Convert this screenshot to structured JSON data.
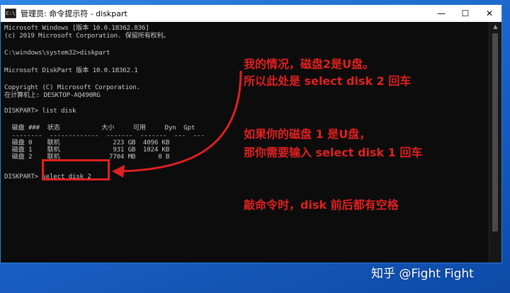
{
  "window": {
    "icon_text": "C:\\",
    "title": "管理员: 命令提示符 - diskpart",
    "minimize_glyph": "—",
    "maximize_glyph": "☐",
    "close_glyph": "✕"
  },
  "console_lines": [
    "Microsoft Windows [版本 10.0.18362.836]",
    "(c) 2019 Microsoft Corporation. 保留所有权利。",
    "",
    "C:\\windows\\system32>diskpart",
    "",
    "Microsoft DiskPart 版本 10.0.18362.1",
    "",
    "Copyright (C) Microsoft Corporation.",
    "在计算机上: DESKTOP-AQ490RG",
    "",
    "DISKPART> list disk",
    "",
    "  磁盘 ###  状态           大小     可用     Dyn  Gpt",
    "  --------  -------------  -------  -------  ---  ---",
    "  磁盘 0    联机              223 GB  4096 KB",
    "  磁盘 1    联机              931 GB  1024 KB",
    "  磁盘 2    联机             7704 MB      0 B",
    "",
    "DISKPART> select disk 2"
  ],
  "annotations": {
    "note1_line1": "我的情况，磁盘2是U盘。",
    "note1_line2": "所以此处是 select disk 2 回车",
    "note2_line1": "如果你的磁盘 1 是U盘，",
    "note2_line2": "那你需要输入 select disk 1 回车",
    "note3": "敲命令时，disk 前后都有空格"
  },
  "watermark": "知乎 @Fight Fight",
  "colors": {
    "annotation_red": "#e02020",
    "console_bg": "#0c0c0c",
    "console_text": "#c8c8c8",
    "desktop_blue": "#1b64c8"
  }
}
